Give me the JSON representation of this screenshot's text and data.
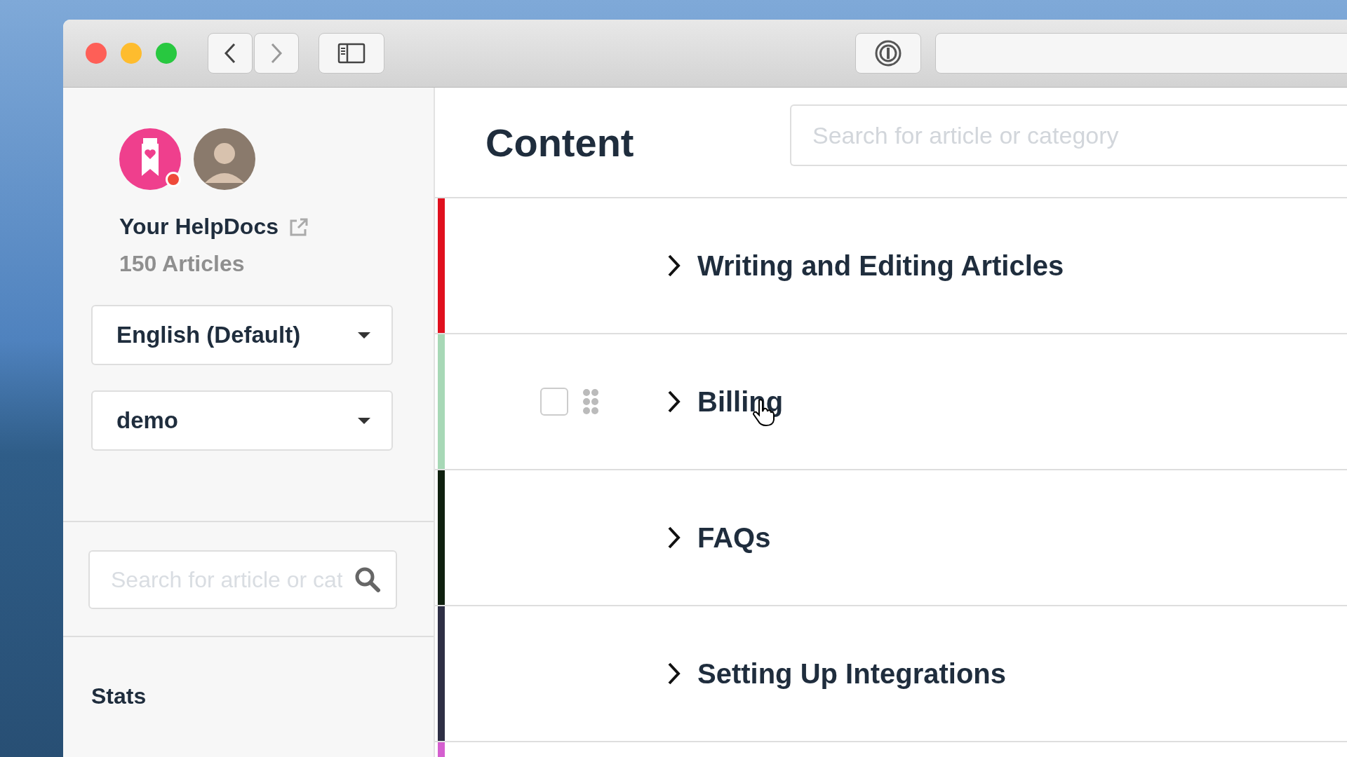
{
  "sidebar": {
    "site_name": "Your HelpDocs",
    "article_count": "150 Articles",
    "language_select": {
      "value": "English (Default)"
    },
    "version_select": {
      "value": "demo"
    },
    "search": {
      "placeholder": "Search for article or cat"
    },
    "section_heading": "Stats"
  },
  "content": {
    "title": "Content",
    "search": {
      "placeholder": "Search for article or category"
    },
    "categories": [
      {
        "title": "Writing and Editing Articles",
        "color": "#e0101e",
        "hovered": false
      },
      {
        "title": "Billing",
        "color": "#a7d8b6",
        "hovered": true,
        "checked": false
      },
      {
        "title": "FAQs",
        "color": "#0f200f",
        "hovered": false
      },
      {
        "title": "Setting Up Integrations",
        "color": "#2e2f45",
        "hovered": false
      },
      {
        "color": "#d45fcf"
      }
    ]
  }
}
